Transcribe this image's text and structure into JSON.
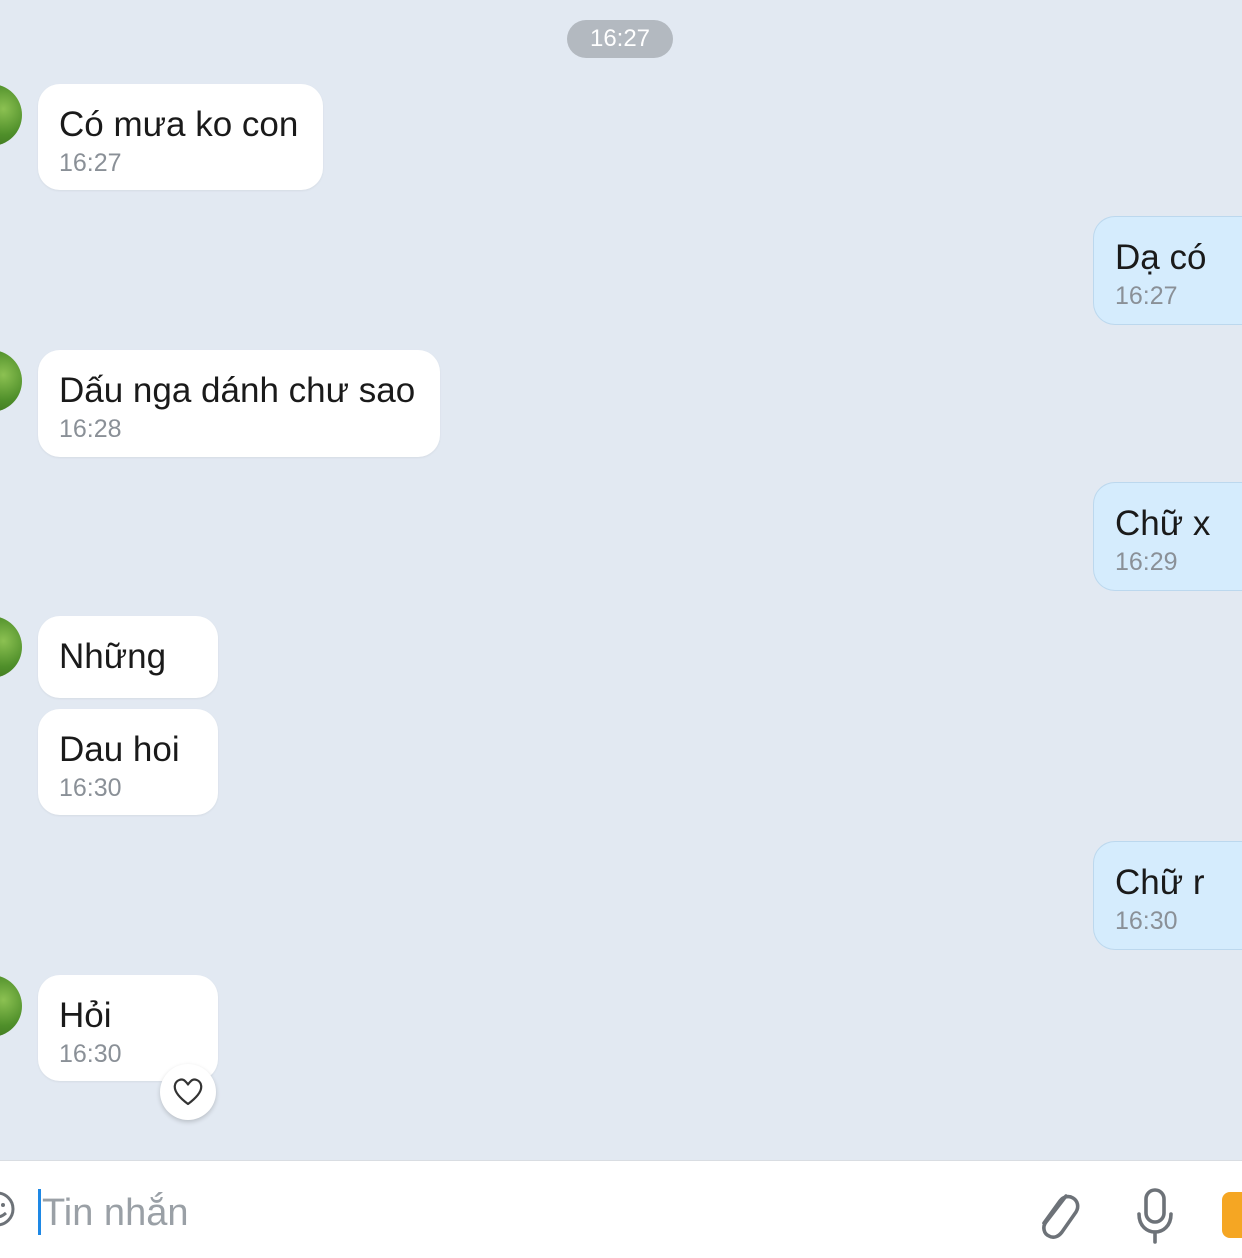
{
  "date_chip": "16:27",
  "messages": [
    {
      "direction": "in",
      "text": "Có mưa ko con",
      "time": "16:27"
    },
    {
      "direction": "out",
      "text": "Dạ có",
      "time": "16:27"
    },
    {
      "direction": "in",
      "text": "Dấu nga dánh chư sao",
      "time": "16:28"
    },
    {
      "direction": "out",
      "text": "Chữ x",
      "time": "16:29"
    },
    {
      "direction": "in",
      "text": "Những",
      "time": ""
    },
    {
      "direction": "in",
      "text": "Dau hoi",
      "time": "16:30"
    },
    {
      "direction": "out",
      "text": "Chữ r",
      "time": "16:30"
    },
    {
      "direction": "in",
      "text": "Hỏi",
      "time": "16:30"
    }
  ],
  "composer": {
    "placeholder": "Tin nhắn",
    "icons": [
      "emoji-icon",
      "attach-icon",
      "mic-icon",
      "image-icon"
    ]
  },
  "reaction_icon": "heart-icon",
  "colors": {
    "background": "#e2e9f2",
    "incoming_bubble": "#ffffff",
    "outgoing_bubble": "#d5ecfd",
    "caret": "#1e88e5"
  }
}
